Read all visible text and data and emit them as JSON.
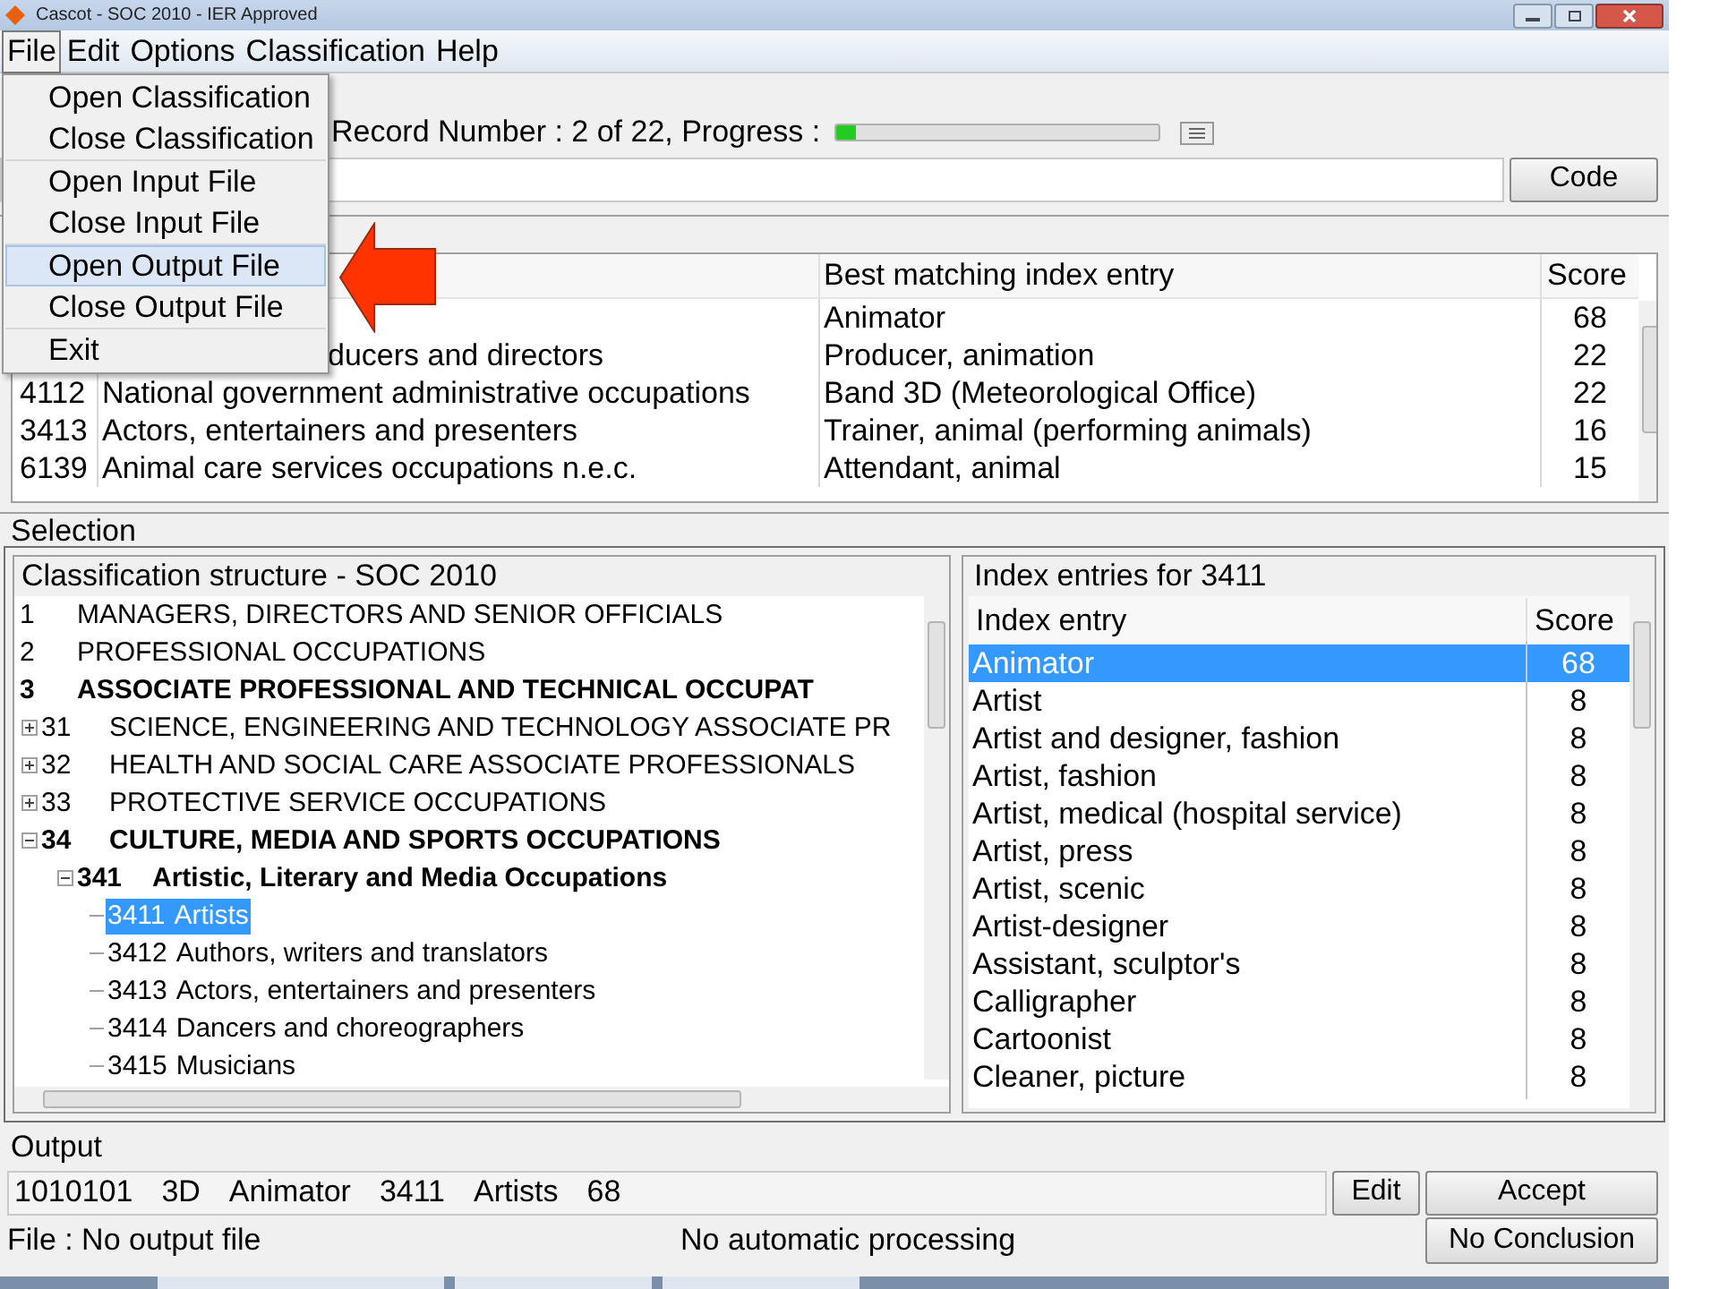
{
  "window": {
    "title": "Cascot - SOC 2010  - IER Approved"
  },
  "menubar": [
    {
      "label": "File",
      "selected": true
    },
    {
      "label": "Edit",
      "selected": false
    },
    {
      "label": "Options",
      "selected": false
    },
    {
      "label": "Classification",
      "selected": false
    },
    {
      "label": "Help",
      "selected": false
    }
  ],
  "file_menu": {
    "groups": [
      [
        {
          "label": "Open Classification",
          "selected": false
        },
        {
          "label": "Close Classification",
          "selected": false
        }
      ],
      [
        {
          "label": "Open Input File",
          "selected": false
        },
        {
          "label": "Close Input File",
          "selected": false
        }
      ],
      [
        {
          "label": "Open Output File",
          "selected": true
        },
        {
          "label": "Close Output File",
          "selected": false
        }
      ],
      [
        {
          "label": "Exit",
          "selected": false
        }
      ]
    ]
  },
  "record": {
    "label": "Record Number : 2 of 22, Progress :",
    "level": 0.06
  },
  "input": {
    "button": "Code"
  },
  "results": {
    "columns": [
      "Best matching index entry",
      "Score"
    ],
    "rows": [
      {
        "entry": "Animator",
        "score": "68"
      },
      {
        "title": "ducers and directors",
        "entry": "Producer, animation",
        "score": "22"
      },
      {
        "code": "4112",
        "title": "National government administrative occupations",
        "entry": "Band 3D (Meteorological Office)",
        "score": "22"
      },
      {
        "code": "3413",
        "title": "Actors, entertainers and presenters",
        "entry": "Trainer, animal (performing animals)",
        "score": "16"
      },
      {
        "code": "6139",
        "title": "Animal care services occupations n.e.c.",
        "entry": "Attendant, animal",
        "score": "15"
      }
    ]
  },
  "selection": {
    "label": "Selection",
    "tree": {
      "title": "Classification structure - SOC 2010",
      "items": [
        {
          "code": "1",
          "title": "MANAGERS, DIRECTORS AND SENIOR OFFICIALS",
          "expanded": false,
          "selected": false
        },
        {
          "code": "2",
          "title": "PROFESSIONAL OCCUPATIONS",
          "expanded": false,
          "selected": false
        },
        {
          "code": "3",
          "title": "ASSOCIATE PROFESSIONAL AND TECHNICAL OCCUPAT",
          "expanded": true,
          "selected": false,
          "children": [
            {
              "code": "31",
              "title": "SCIENCE, ENGINEERING AND TECHNOLOGY ASSOCIATE PR",
              "expanded": false,
              "selected": false
            },
            {
              "code": "32",
              "title": "HEALTH AND SOCIAL CARE ASSOCIATE PROFESSIONALS",
              "expanded": false,
              "selected": false
            },
            {
              "code": "33",
              "title": "PROTECTIVE SERVICE OCCUPATIONS",
              "expanded": false,
              "selected": false
            },
            {
              "code": "34",
              "title": "CULTURE, MEDIA AND SPORTS OCCUPATIONS",
              "expanded": true,
              "selected": false,
              "children": [
                {
                  "code": "341",
                  "title": "Artistic, Literary and Media Occupations",
                  "expanded": true,
                  "selected": false,
                  "children": [
                    {
                      "code": "3411",
                      "title": "Artists",
                      "selected": true
                    },
                    {
                      "code": "3412",
                      "title": "Authors, writers and translators",
                      "selected": false
                    },
                    {
                      "code": "3413",
                      "title": "Actors, entertainers and presenters",
                      "selected": false
                    },
                    {
                      "code": "3414",
                      "title": "Dancers and choreographers",
                      "selected": false
                    },
                    {
                      "code": "3415",
                      "title": "Musicians",
                      "selected": false
                    }
                  ]
                }
              ]
            }
          ]
        }
      ]
    },
    "index": {
      "title": "Index entries for 3411",
      "columns": [
        "Index entry",
        "Score"
      ],
      "rows": [
        {
          "entry": "Animator",
          "score": "68",
          "selected": true
        },
        {
          "entry": "Artist",
          "score": "8",
          "selected": false
        },
        {
          "entry": "Artist and designer, fashion",
          "score": "8",
          "selected": false
        },
        {
          "entry": "Artist, fashion",
          "score": "8",
          "selected": false
        },
        {
          "entry": "Artist, medical (hospital service)",
          "score": "8",
          "selected": false
        },
        {
          "entry": "Artist, press",
          "score": "8",
          "selected": false
        },
        {
          "entry": "Artist, scenic",
          "score": "8",
          "selected": false
        },
        {
          "entry": "Artist-designer",
          "score": "8",
          "selected": false
        },
        {
          "entry": "Assistant, sculptor's",
          "score": "8",
          "selected": false
        },
        {
          "entry": "Calligrapher",
          "score": "8",
          "selected": false
        },
        {
          "entry": "Cartoonist",
          "score": "8",
          "selected": false
        },
        {
          "entry": "Cleaner, picture",
          "score": "8",
          "selected": false
        }
      ]
    }
  },
  "output": {
    "label": "Output",
    "parts": [
      "1010101",
      "3D",
      "Animator",
      "3411",
      "Artists",
      "68"
    ],
    "buttons": [
      "Edit",
      "Accept"
    ]
  },
  "status": {
    "file": "File : No output file",
    "processing": "No automatic processing",
    "button": "No Conclusion"
  }
}
